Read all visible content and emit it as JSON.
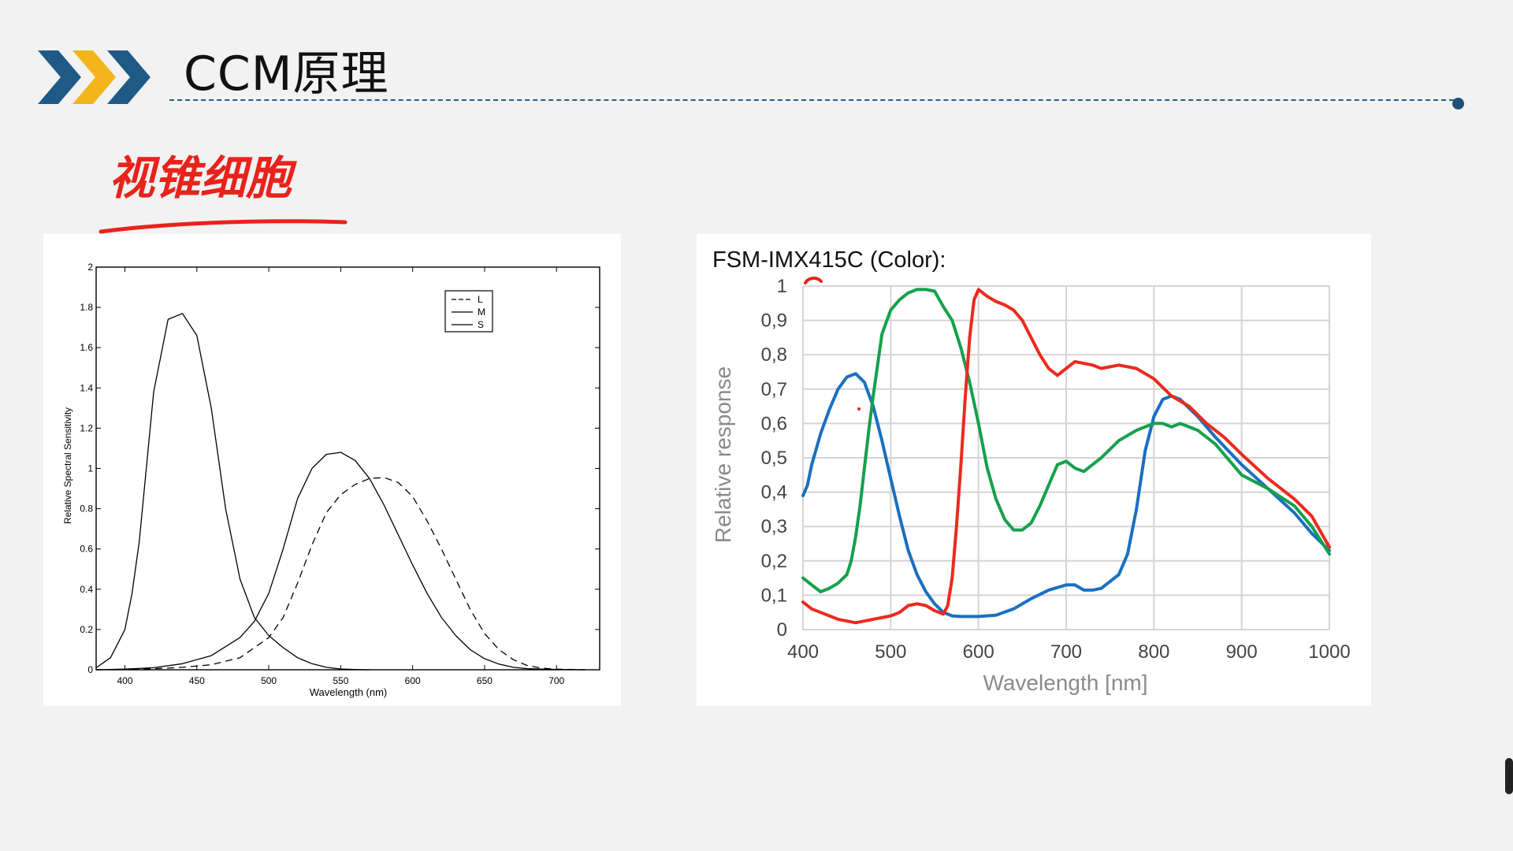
{
  "slide": {
    "title": "CCM原理",
    "annotation": "视锥细胞"
  },
  "colors": {
    "chevron_blue": "#1f5a86",
    "chevron_yellow": "#f2b51c",
    "rule": "#2e5f82",
    "annotation_red": "#e8231b",
    "sensor_red": "#ec2a1e",
    "sensor_green": "#16a04d",
    "sensor_blue": "#1b6fc0"
  },
  "chart_data": [
    {
      "type": "line",
      "title": "",
      "xlabel": "Wavelength (nm)",
      "ylabel": "Relative Spectral Sensitivity",
      "xlim": [
        380,
        730
      ],
      "ylim": [
        0,
        2
      ],
      "x_ticks": [
        400,
        450,
        500,
        550,
        600,
        650,
        700
      ],
      "x_tick_labels": [
        "400",
        "450",
        "500",
        "550",
        "600",
        "650",
        "700"
      ],
      "y_ticks": [
        0,
        0.2,
        0.4,
        0.6,
        0.8,
        1,
        1.2,
        1.4,
        1.6,
        1.8,
        2
      ],
      "y_tick_labels": [
        "0",
        "0.2",
        "0.4",
        "0.6",
        "0.8",
        "1",
        "1.2",
        "1.4",
        "1.6",
        "1.8",
        "2"
      ],
      "grid": false,
      "legend": "top-right",
      "series": [
        {
          "name": "L",
          "style": "dashed",
          "x": [
            380,
            400,
            420,
            440,
            460,
            480,
            500,
            510,
            520,
            530,
            540,
            550,
            560,
            570,
            580,
            590,
            600,
            610,
            620,
            630,
            640,
            650,
            660,
            670,
            680,
            690,
            700,
            720
          ],
          "y": [
            0,
            0.002,
            0.005,
            0.012,
            0.025,
            0.06,
            0.16,
            0.26,
            0.43,
            0.62,
            0.78,
            0.87,
            0.92,
            0.95,
            0.955,
            0.93,
            0.86,
            0.74,
            0.6,
            0.45,
            0.3,
            0.18,
            0.1,
            0.05,
            0.02,
            0.008,
            0.003,
            0
          ]
        },
        {
          "name": "M",
          "style": "solid",
          "x": [
            380,
            400,
            420,
            440,
            460,
            480,
            490,
            500,
            510,
            520,
            530,
            540,
            550,
            560,
            570,
            580,
            590,
            600,
            610,
            620,
            630,
            640,
            650,
            660,
            670,
            680,
            700,
            720
          ],
          "y": [
            0,
            0.003,
            0.01,
            0.03,
            0.07,
            0.16,
            0.24,
            0.38,
            0.6,
            0.85,
            1.0,
            1.07,
            1.08,
            1.04,
            0.95,
            0.82,
            0.67,
            0.52,
            0.38,
            0.26,
            0.17,
            0.1,
            0.055,
            0.028,
            0.012,
            0.005,
            0.001,
            0
          ]
        },
        {
          "name": "S",
          "style": "solid",
          "x": [
            380,
            390,
            400,
            405,
            410,
            420,
            430,
            440,
            450,
            460,
            470,
            480,
            490,
            500,
            510,
            520,
            530,
            540,
            550,
            560,
            570
          ],
          "y": [
            0.01,
            0.06,
            0.2,
            0.38,
            0.64,
            1.38,
            1.74,
            1.77,
            1.66,
            1.3,
            0.8,
            0.45,
            0.26,
            0.17,
            0.11,
            0.06,
            0.03,
            0.012,
            0.004,
            0.001,
            0
          ]
        }
      ]
    },
    {
      "type": "line",
      "title": "FSM-IMX415C (Color):",
      "xlabel": "Wavelength [nm]",
      "ylabel": "Relative response",
      "xlim": [
        400,
        1000
      ],
      "ylim": [
        0,
        1
      ],
      "x_ticks": [
        400,
        500,
        600,
        700,
        800,
        900,
        1000
      ],
      "x_tick_labels": [
        "400",
        "500",
        "600",
        "700",
        "800",
        "900",
        "1000"
      ],
      "y_ticks": [
        0,
        0.1,
        0.2,
        0.3,
        0.4,
        0.5,
        0.6,
        0.7,
        0.8,
        0.9,
        1
      ],
      "y_tick_labels": [
        "0",
        "0,1",
        "0,2",
        "0,3",
        "0,4",
        "0,5",
        "0,6",
        "0,7",
        "0,8",
        "0,9",
        "1"
      ],
      "grid": true,
      "legend": "none",
      "series": [
        {
          "color": "blue",
          "x": [
            400,
            405,
            410,
            420,
            430,
            440,
            450,
            460,
            470,
            480,
            490,
            500,
            510,
            520,
            530,
            540,
            550,
            560,
            570,
            580,
            600,
            620,
            640,
            660,
            680,
            700,
            710,
            720,
            730,
            740,
            760,
            770,
            780,
            790,
            800,
            810,
            820,
            830,
            850,
            870,
            900,
            930,
            960,
            980,
            1000
          ],
          "y": [
            0.39,
            0.42,
            0.48,
            0.57,
            0.64,
            0.7,
            0.735,
            0.745,
            0.72,
            0.65,
            0.55,
            0.44,
            0.33,
            0.23,
            0.16,
            0.11,
            0.075,
            0.05,
            0.04,
            0.038,
            0.038,
            0.042,
            0.06,
            0.09,
            0.115,
            0.13,
            0.13,
            0.115,
            0.115,
            0.12,
            0.16,
            0.22,
            0.35,
            0.52,
            0.62,
            0.67,
            0.68,
            0.67,
            0.62,
            0.56,
            0.48,
            0.41,
            0.34,
            0.28,
            0.23
          ]
        },
        {
          "color": "green",
          "x": [
            400,
            410,
            420,
            430,
            440,
            450,
            455,
            460,
            465,
            470,
            475,
            480,
            490,
            500,
            510,
            520,
            530,
            540,
            550,
            560,
            570,
            580,
            590,
            600,
            610,
            620,
            630,
            640,
            650,
            660,
            670,
            680,
            690,
            700,
            710,
            720,
            730,
            740,
            760,
            780,
            800,
            810,
            820,
            830,
            850,
            870,
            900,
            930,
            960,
            980,
            1000
          ],
          "y": [
            0.15,
            0.13,
            0.11,
            0.12,
            0.135,
            0.16,
            0.2,
            0.27,
            0.36,
            0.47,
            0.58,
            0.68,
            0.86,
            0.93,
            0.96,
            0.98,
            0.99,
            0.99,
            0.985,
            0.94,
            0.9,
            0.82,
            0.72,
            0.6,
            0.47,
            0.38,
            0.32,
            0.29,
            0.29,
            0.31,
            0.36,
            0.42,
            0.48,
            0.49,
            0.47,
            0.46,
            0.48,
            0.5,
            0.55,
            0.58,
            0.6,
            0.6,
            0.59,
            0.6,
            0.58,
            0.54,
            0.45,
            0.41,
            0.36,
            0.3,
            0.22
          ]
        },
        {
          "color": "red",
          "x": [
            400,
            410,
            420,
            440,
            460,
            480,
            500,
            510,
            520,
            530,
            540,
            550,
            555,
            560,
            565,
            570,
            575,
            580,
            585,
            590,
            595,
            600,
            610,
            620,
            630,
            640,
            650,
            660,
            670,
            680,
            690,
            700,
            710,
            720,
            730,
            740,
            760,
            780,
            800,
            820,
            840,
            860,
            880,
            900,
            930,
            960,
            980,
            1000
          ],
          "y": [
            0.08,
            0.06,
            0.05,
            0.03,
            0.02,
            0.03,
            0.04,
            0.05,
            0.07,
            0.075,
            0.07,
            0.055,
            0.05,
            0.045,
            0.07,
            0.15,
            0.3,
            0.48,
            0.68,
            0.85,
            0.96,
            0.99,
            0.97,
            0.955,
            0.945,
            0.93,
            0.9,
            0.85,
            0.8,
            0.76,
            0.74,
            0.76,
            0.78,
            0.775,
            0.77,
            0.76,
            0.77,
            0.76,
            0.73,
            0.68,
            0.65,
            0.6,
            0.56,
            0.51,
            0.44,
            0.38,
            0.33,
            0.24
          ]
        }
      ]
    }
  ]
}
